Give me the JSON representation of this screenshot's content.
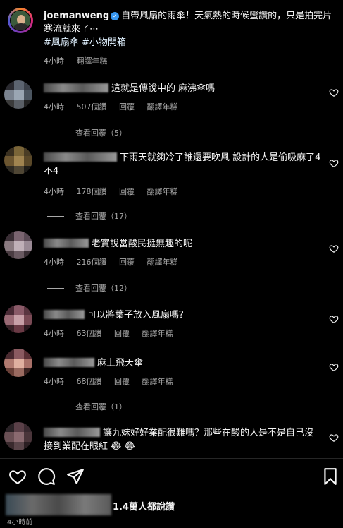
{
  "post": {
    "username": "joemanweng",
    "caption": "自帶風扇的雨傘！天氣熱的時候蠻讚的，只是拍完片寒流就來了⋯",
    "hashtags": "#風扇傘 #小物開箱",
    "time": "4小時",
    "translate": "翻譯年糕"
  },
  "comments": [
    {
      "text": "這就是傳說中的 麻沸傘嗎",
      "time": "4小時",
      "likes": "507個讚",
      "reply": "回覆",
      "translate": "翻譯年糕",
      "view_replies": "查看回覆（5）"
    },
    {
      "text": "下雨天就夠冷了誰還要吹風 設計的人是偷吸麻了4不4",
      "time": "4小時",
      "likes": "178個讚",
      "reply": "回覆",
      "translate": "翻譯年糕",
      "view_replies": "查看回覆（17）"
    },
    {
      "text": "老實說當酸民挺無趣的呢",
      "time": "4小時",
      "likes": "216個讚",
      "reply": "回覆",
      "translate": "翻譯年糕",
      "view_replies": "查看回覆（12）"
    },
    {
      "text": "可以將葉子放入風扇嗎？",
      "time": "4小時",
      "likes": "63個讚",
      "reply": "回覆",
      "translate": "翻譯年糕",
      "view_replies": ""
    },
    {
      "text": "麻上飛天傘",
      "time": "4小時",
      "likes": "68個讚",
      "reply": "回覆",
      "translate": "翻譯年糕",
      "view_replies": "查看回覆（1）"
    },
    {
      "text": "讓九妹好好業配很難嗎？那些在酸的人是不是自己沒接到業配在眼紅 😂 😂",
      "time": "",
      "likes": "",
      "reply": "",
      "translate": "",
      "view_replies": ""
    }
  ],
  "footer": {
    "likes_text": "1.4萬人都說讚",
    "post_time": "4小時前"
  },
  "icons": {
    "like": "heart-icon",
    "comment": "comment-icon",
    "share": "send-icon",
    "save": "bookmark-icon"
  }
}
